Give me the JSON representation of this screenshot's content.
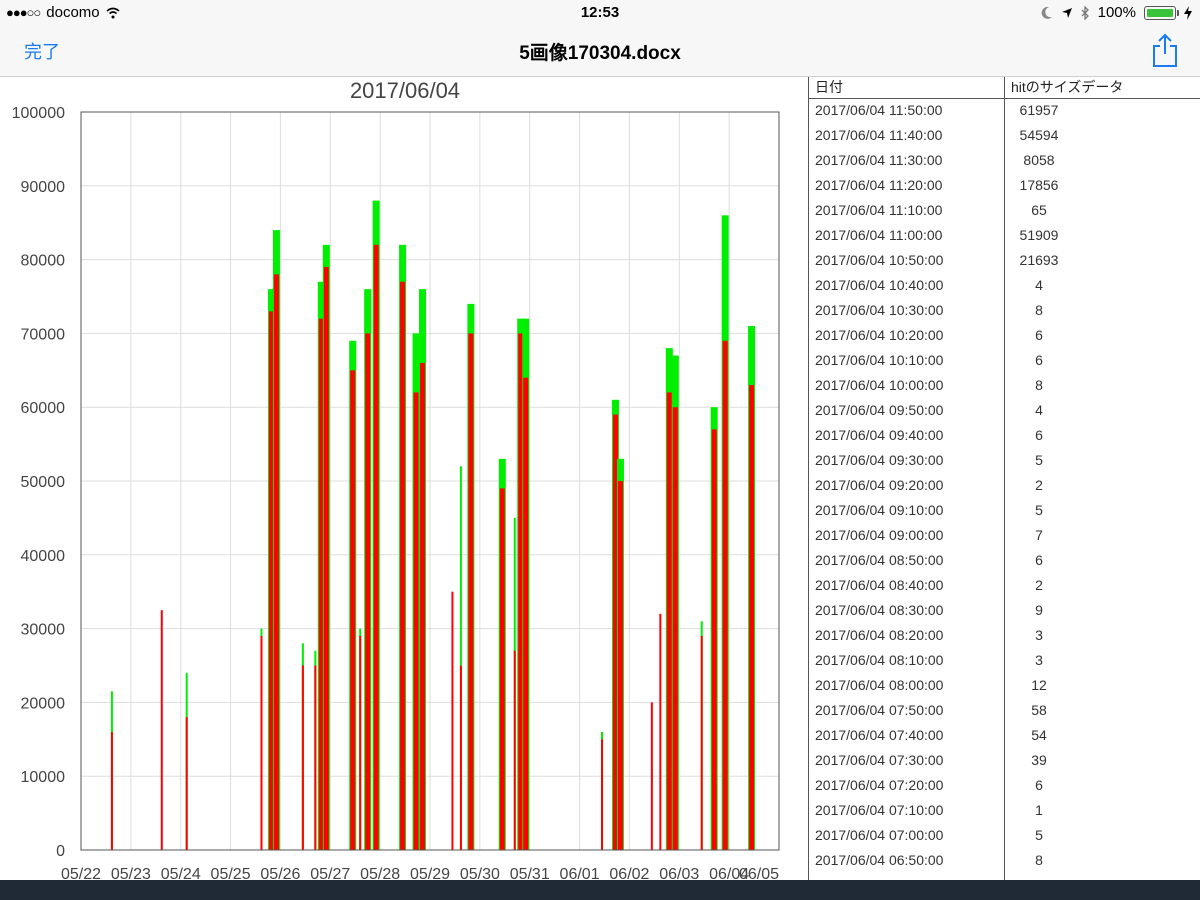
{
  "status_bar": {
    "signal": "●●●○○",
    "carrier": "docomo",
    "time": "12:53",
    "battery": "100%",
    "icons": [
      "moon-icon",
      "location-arrow-icon",
      "bluetooth-icon",
      "battery-icon",
      "charging-icon"
    ]
  },
  "nav": {
    "done_label": "完了",
    "title": "5画像170304.docx",
    "share_icon": "share-icon",
    "accent_color": "#1a7cf0"
  },
  "chart_data": {
    "type": "bar",
    "title": "2017/06/04",
    "ylim": [
      0,
      100000
    ],
    "yticks": [
      "100000",
      "90000",
      "80000",
      "70000",
      "60000",
      "50000",
      "40000",
      "30000",
      "20000",
      "10000",
      "0"
    ],
    "categories": [
      "05/22",
      "05/23",
      "05/24",
      "05/25",
      "05/26",
      "05/27",
      "05/28",
      "05/29",
      "05/30",
      "05/31",
      "06/01",
      "06/02",
      "06/03",
      "06/04",
      "06/05"
    ],
    "grid": true,
    "series_colors": [
      "#ff0000",
      "#00ee00"
    ],
    "peaks": [
      {
        "x": 0.62,
        "red": 16000,
        "green": 21500
      },
      {
        "x": 1.62,
        "red": 32500,
        "green": 32500
      },
      {
        "x": 2.12,
        "red": 18000,
        "green": 24000
      },
      {
        "x": 3.62,
        "red": 29000,
        "green": 30000
      },
      {
        "x": 3.82,
        "red": 73000,
        "green": 76000
      },
      {
        "x": 3.92,
        "red": 78000,
        "green": 84000
      },
      {
        "x": 4.45,
        "red": 25000,
        "green": 28000
      },
      {
        "x": 4.7,
        "red": 25000,
        "green": 27000
      },
      {
        "x": 4.82,
        "red": 72000,
        "green": 77000
      },
      {
        "x": 4.92,
        "red": 79000,
        "green": 82000
      },
      {
        "x": 5.45,
        "red": 65000,
        "green": 69000
      },
      {
        "x": 5.6,
        "red": 29000,
        "green": 30000
      },
      {
        "x": 5.75,
        "red": 70000,
        "green": 76000
      },
      {
        "x": 5.92,
        "red": 82000,
        "green": 88000
      },
      {
        "x": 6.45,
        "red": 77000,
        "green": 82000
      },
      {
        "x": 6.72,
        "red": 62000,
        "green": 70000
      },
      {
        "x": 6.85,
        "red": 66000,
        "green": 76000
      },
      {
        "x": 7.45,
        "red": 35000,
        "green": 35000
      },
      {
        "x": 7.62,
        "red": 25000,
        "green": 52000
      },
      {
        "x": 7.82,
        "red": 70000,
        "green": 74000
      },
      {
        "x": 8.45,
        "red": 49000,
        "green": 53000
      },
      {
        "x": 8.7,
        "red": 27000,
        "green": 45000
      },
      {
        "x": 8.82,
        "red": 70000,
        "green": 72000
      },
      {
        "x": 8.92,
        "red": 64000,
        "green": 72000
      },
      {
        "x": 10.45,
        "red": 15000,
        "green": 16000
      },
      {
        "x": 10.72,
        "red": 59000,
        "green": 61000
      },
      {
        "x": 10.82,
        "red": 50000,
        "green": 53000
      },
      {
        "x": 11.45,
        "red": 20000,
        "green": 20000
      },
      {
        "x": 11.62,
        "red": 32000,
        "green": 32000
      },
      {
        "x": 11.8,
        "red": 62000,
        "green": 68000
      },
      {
        "x": 11.92,
        "red": 60000,
        "green": 67000
      },
      {
        "x": 12.45,
        "red": 29000,
        "green": 31000
      },
      {
        "x": 12.7,
        "red": 57000,
        "green": 60000
      },
      {
        "x": 12.92,
        "red": 69000,
        "green": 86000
      },
      {
        "x": 13.45,
        "red": 63000,
        "green": 71000
      }
    ]
  },
  "table": {
    "headers": [
      "日付",
      "hitのサイズデータ"
    ],
    "rows": [
      {
        "date": "2017/06/04 11:50:00",
        "size": "61957"
      },
      {
        "date": "2017/06/04 11:40:00",
        "size": "54594"
      },
      {
        "date": "2017/06/04 11:30:00",
        "size": "8058"
      },
      {
        "date": "2017/06/04 11:20:00",
        "size": "17856"
      },
      {
        "date": "2017/06/04 11:10:00",
        "size": "65"
      },
      {
        "date": "2017/06/04 11:00:00",
        "size": "51909"
      },
      {
        "date": "2017/06/04 10:50:00",
        "size": "21693"
      },
      {
        "date": "2017/06/04 10:40:00",
        "size": "4"
      },
      {
        "date": "2017/06/04 10:30:00",
        "size": "8"
      },
      {
        "date": "2017/06/04 10:20:00",
        "size": "6"
      },
      {
        "date": "2017/06/04 10:10:00",
        "size": "6"
      },
      {
        "date": "2017/06/04 10:00:00",
        "size": "8"
      },
      {
        "date": "2017/06/04 09:50:00",
        "size": "4"
      },
      {
        "date": "2017/06/04 09:40:00",
        "size": "6"
      },
      {
        "date": "2017/06/04 09:30:00",
        "size": "5"
      },
      {
        "date": "2017/06/04 09:20:00",
        "size": "2"
      },
      {
        "date": "2017/06/04 09:10:00",
        "size": "5"
      },
      {
        "date": "2017/06/04 09:00:00",
        "size": "7"
      },
      {
        "date": "2017/06/04 08:50:00",
        "size": "6"
      },
      {
        "date": "2017/06/04 08:40:00",
        "size": "2"
      },
      {
        "date": "2017/06/04 08:30:00",
        "size": "9"
      },
      {
        "date": "2017/06/04 08:20:00",
        "size": "3"
      },
      {
        "date": "2017/06/04 08:10:00",
        "size": "3"
      },
      {
        "date": "2017/06/04 08:00:00",
        "size": "12"
      },
      {
        "date": "2017/06/04 07:50:00",
        "size": "58"
      },
      {
        "date": "2017/06/04 07:40:00",
        "size": "54"
      },
      {
        "date": "2017/06/04 07:30:00",
        "size": "39"
      },
      {
        "date": "2017/06/04 07:20:00",
        "size": "6"
      },
      {
        "date": "2017/06/04 07:10:00",
        "size": "1"
      },
      {
        "date": "2017/06/04 07:00:00",
        "size": "5"
      },
      {
        "date": "2017/06/04 06:50:00",
        "size": "8"
      }
    ]
  }
}
